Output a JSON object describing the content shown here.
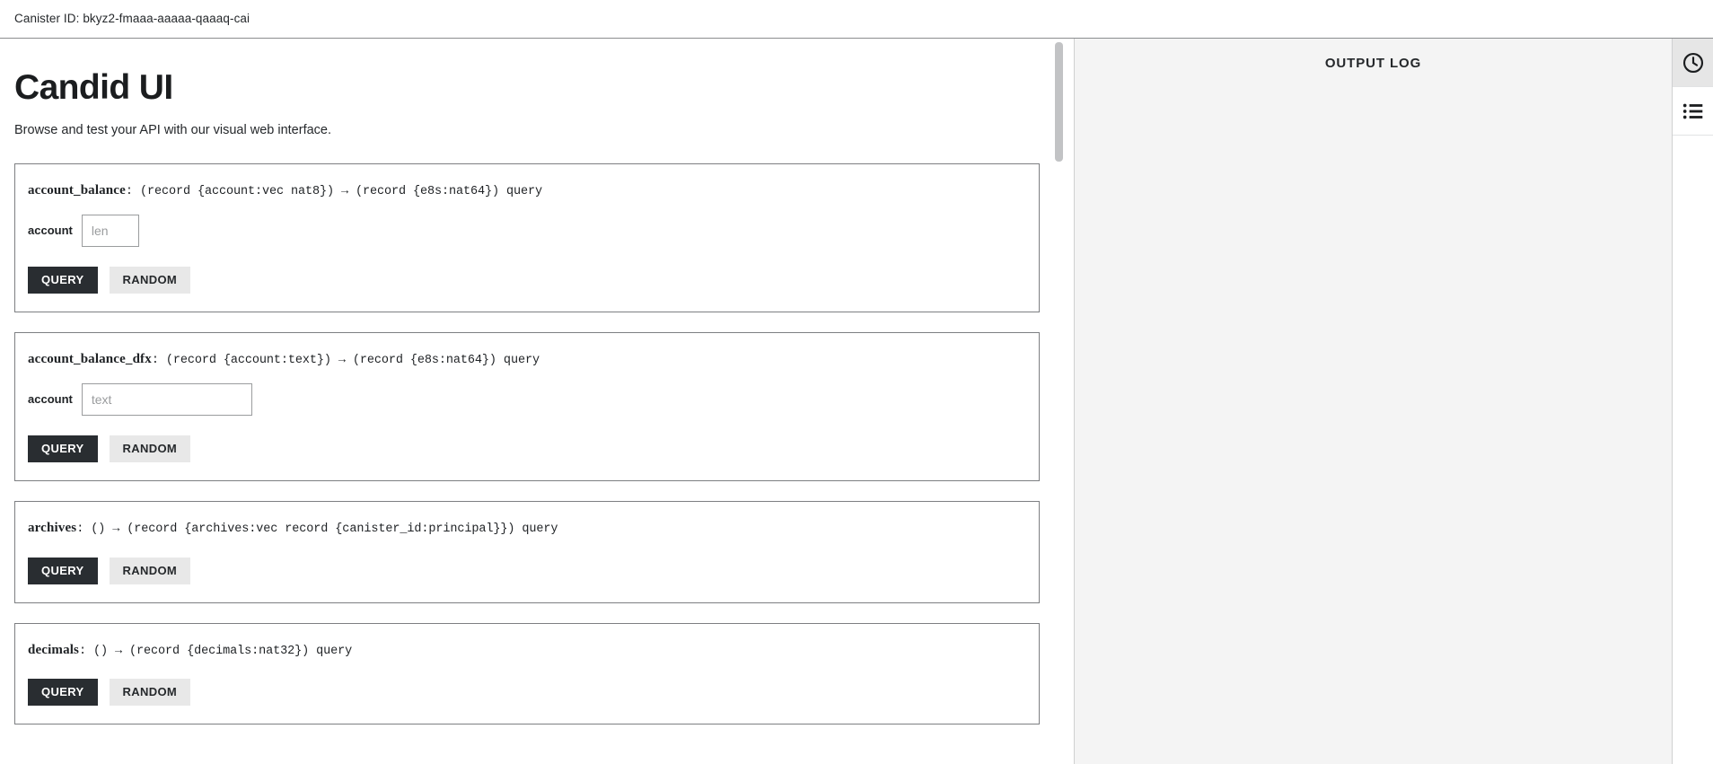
{
  "topbar": {
    "canister_id_label": "Canister ID: bkyz2-fmaaa-aaaaa-qaaaq-cai"
  },
  "main": {
    "title": "Candid UI",
    "subtitle": "Browse and test your API with our visual web interface.",
    "methods": [
      {
        "name": "account_balance",
        "separator": ": ",
        "type": "(record {account:vec nat8}) → (record {e8s:nat64}) query",
        "args": [
          {
            "label": "account",
            "placeholder": "len",
            "value": "",
            "width": "narrow"
          }
        ],
        "primary_button": "QUERY",
        "secondary_button": "RANDOM"
      },
      {
        "name": "account_balance_dfx",
        "separator": ": ",
        "type": "(record {account:text}) → (record {e8s:nat64}) query",
        "args": [
          {
            "label": "account",
            "placeholder": "text",
            "value": "",
            "width": "wide"
          }
        ],
        "primary_button": "QUERY",
        "secondary_button": "RANDOM"
      },
      {
        "name": "archives",
        "separator": ": ",
        "type": "() → (record {archives:vec record {canister_id:principal}}) query",
        "args": [],
        "primary_button": "QUERY",
        "secondary_button": "RANDOM"
      },
      {
        "name": "decimals",
        "separator": ": ",
        "type": "() → (record {decimals:nat32}) query",
        "args": [],
        "primary_button": "QUERY",
        "secondary_button": "RANDOM"
      }
    ]
  },
  "output_log": {
    "title": "OUTPUT LOG",
    "entries": []
  },
  "icon_rail": {
    "items": [
      {
        "icon": "clock-icon",
        "active": true
      },
      {
        "icon": "list-icon",
        "active": false
      }
    ]
  },
  "colors": {
    "primary_button_bg": "#292d31",
    "secondary_button_bg": "#e8e8e8",
    "panel_bg": "#f4f4f4",
    "card_border": "#7d7f82",
    "text": "#25282b"
  }
}
